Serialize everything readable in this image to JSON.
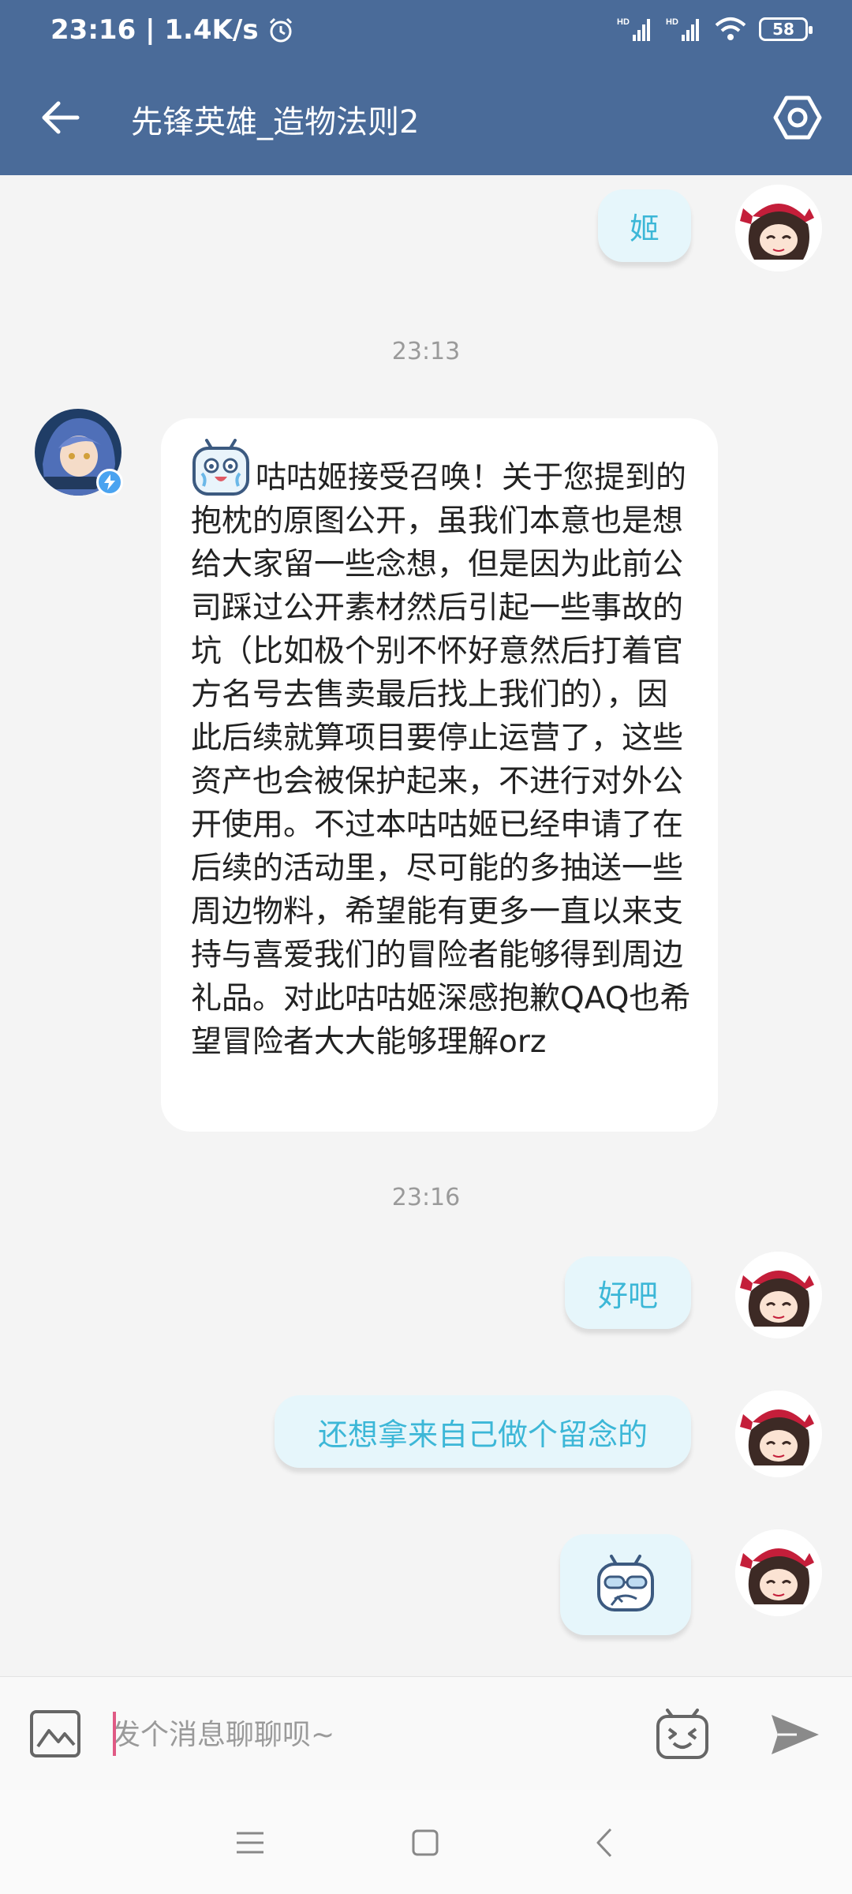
{
  "status_bar": {
    "time_speed": "23:16 | 1.4K/s",
    "battery": "58"
  },
  "header": {
    "title": "先锋英雄_造物法则2"
  },
  "messages": {
    "msg1": "姬",
    "timestamp1": "23:13",
    "reply": "咕咕姬接受召唤！关于您提到的抱枕的原图公开，虽我们本意也是想给大家留一些念想，但是因为此前公司踩过公开素材然后引起一些事故的坑（比如极个别不怀好意然后打着官方名号去售卖最后找上我们的），因此后续就算项目要停止运营了，这些资产也会被保护起来，不进行对外公开使用。不过本咕咕姬已经申请了在后续的活动里，尽可能的多抽送一些周边物料，希望能有更多一直以来支持与喜爱我们的冒险者能够得到周边礼品。对此咕咕姬深感抱歉QAQ也希望冒险者大大能够理解orz",
    "timestamp2": "23:16",
    "msg2": "好吧",
    "msg3": "还想拿来自己做个留念的"
  },
  "input_bar": {
    "placeholder": "发个消息聊聊呗~"
  },
  "colors": {
    "header": "#4a6b99",
    "my_bubble": "#e6f6fb",
    "my_text": "#3cb7d7",
    "background": "#f4f4f4"
  }
}
